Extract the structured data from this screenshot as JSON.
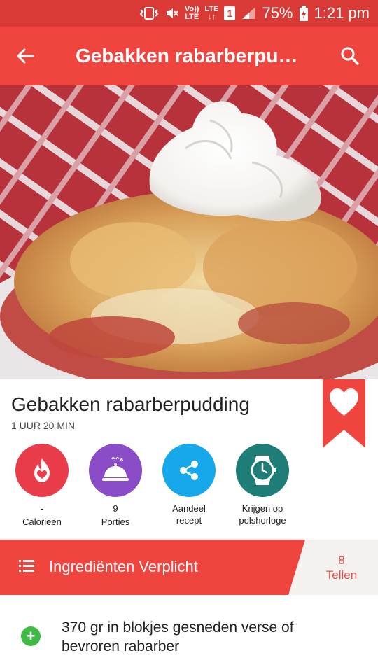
{
  "status_bar": {
    "volte_line1": "Vo))",
    "volte_line2": "LTE",
    "network_line1": "LTE",
    "network_line2": "↓↑",
    "sim_slot": "1",
    "battery": "75%",
    "time": "1:21 pm"
  },
  "app_bar": {
    "title": "Gebakken rabarberpudding",
    "back_icon": "arrow-left-icon",
    "search_icon": "search-icon"
  },
  "recipe": {
    "title": "Gebakken rabarberpudding",
    "time": "1 UUR 20 MIN"
  },
  "actions": [
    {
      "value": "-",
      "label": "Calorieën",
      "icon": "flame-heart-icon",
      "color": "#ea3b4b"
    },
    {
      "value": "9",
      "label": "Porties",
      "icon": "cloche-icon",
      "color": "#8a4cc7"
    },
    {
      "value": "Aandeel",
      "label": "recept",
      "icon": "share-icon",
      "color": "#16a8eb"
    },
    {
      "value": "Krijgen op",
      "label": "polshorloge",
      "icon": "watch-icon",
      "color": "#1e7d76"
    }
  ],
  "ingredients_bar": {
    "label": "Ingrediënten Verplicht",
    "count": "8",
    "count_label": "Tellen"
  },
  "ingredients": [
    {
      "text": "370 gr in blokjes gesneden verse of bevroren rabarber"
    }
  ],
  "colors": {
    "status_bar": "#d93a36",
    "app_bar": "#f0453f",
    "accent": "#f0453f",
    "add_green": "#3dbb45"
  }
}
